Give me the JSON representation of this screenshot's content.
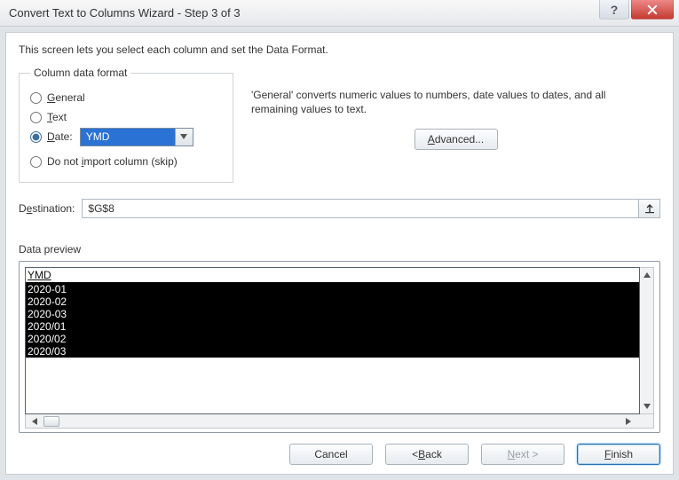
{
  "titlebar": {
    "title": "Convert Text to Columns Wizard - Step 3 of 3"
  },
  "intro": "This screen lets you select each column and set the Data Format.",
  "format_group": {
    "legend": "Column data format",
    "general": "General",
    "text": "Text",
    "date": "Date:",
    "date_value": "YMD",
    "skip": "Do not import column (skip)"
  },
  "desc": "'General' converts numeric values to numbers, date values to dates, and all remaining values to text.",
  "advanced_label": "Advanced...",
  "destination": {
    "label": "Destination:",
    "value": "$G$8"
  },
  "preview": {
    "label": "Data preview",
    "header": "YMD",
    "rows": [
      "2020-01",
      "2020-02",
      "2020-03",
      "2020/01",
      "2020/02",
      "2020/03"
    ]
  },
  "footer": {
    "cancel": "Cancel",
    "back": "< Back",
    "next": "Next >",
    "finish": "Finish"
  }
}
